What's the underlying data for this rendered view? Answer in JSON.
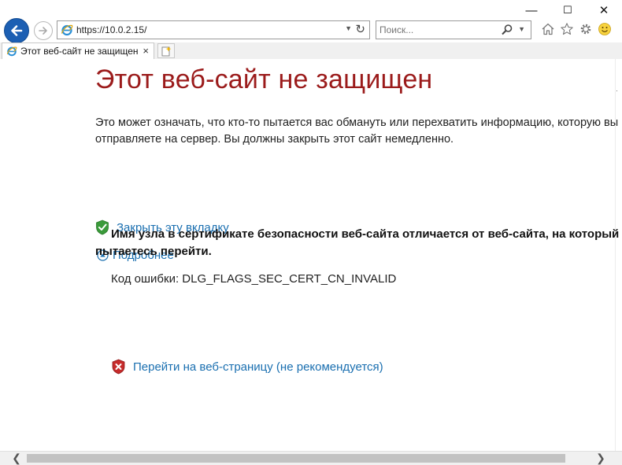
{
  "window": {
    "minimize_glyph": "—",
    "maximize_glyph": "☐",
    "close_glyph": "✕"
  },
  "toolbar": {
    "url": "https://10.0.2.15/",
    "search_placeholder": "Поиск...",
    "icons": [
      "back-icon",
      "forward-icon",
      "ie-logo-icon",
      "refresh-icon",
      "search-icon",
      "home-icon",
      "favorites-star-icon",
      "gear-icon",
      "smiley-feedback-icon"
    ]
  },
  "tab": {
    "title": "Этот веб-сайт не защищен",
    "close_glyph": "×"
  },
  "page": {
    "title": "Этот веб-сайт не защищен",
    "description": "Это может означать, что кто-то пытается вас обмануть или перехватить информацию, которую вы отправляете на сервер. Вы должны закрыть этот сайт немедленно.",
    "close_tab_link": "Закрыть эту вкладку",
    "more_info_link": "Подробнее",
    "cert_message": "Имя узла в сертификате безопасности веб-сайта отличается от веб-сайта, на который вы пытаетесь перейти.",
    "error_code": "Код ошибки: DLG_FLAGS_SEC_CERT_CN_INVALID",
    "continue_link": "Перейти на веб-страницу (не рекомендуется)"
  },
  "colors": {
    "title_red": "#9b1b1b",
    "link_blue": "#1a6fb0",
    "back_button_blue": "#1c5fb3"
  }
}
